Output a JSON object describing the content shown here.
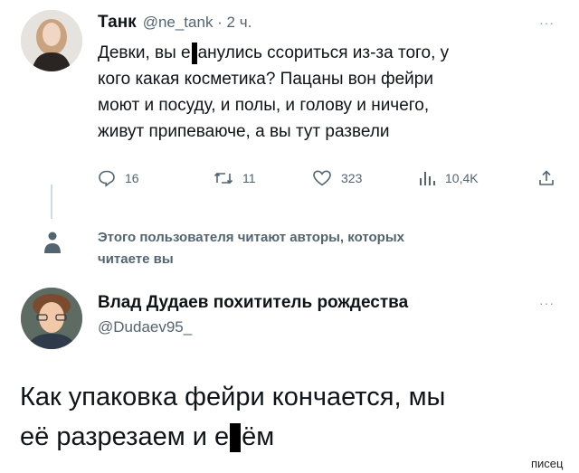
{
  "tweet": {
    "author_name": "Танк",
    "author_meta": "@ne_tank · 2 ч.",
    "more_label": "···",
    "body_lines": [
      {
        "pre": "Девки, вы е",
        "censored": true,
        "post": "анулись ссориться из-за того, у"
      },
      {
        "text": "кого какая косметика? Пацаны вон фейри"
      },
      {
        "text": "моют и посуду, и полы, и голову и ничего,"
      },
      {
        "text": "живут припеваюче, а вы тут развели"
      }
    ],
    "actions": {
      "reply_count": "16",
      "retweet_count": "11",
      "like_count": "323",
      "views_count": "10,4K"
    }
  },
  "follow_notice": {
    "line1": "Этого пользователя читают авторы, которых",
    "line2": "читаете вы"
  },
  "reply": {
    "author_name": "Влад Дудаев похититель рождества",
    "author_handle": "@Dudaev95_",
    "more_label": "···",
    "line1": "Как упаковка фейри кончается, мы",
    "line2_pre": "её разрезаем и е",
    "line2_post": "ём"
  },
  "watermark": "писец",
  "colors": {
    "text": "#0f1419",
    "muted": "#536471",
    "action_icon": "#536471",
    "censor": "#000000"
  }
}
